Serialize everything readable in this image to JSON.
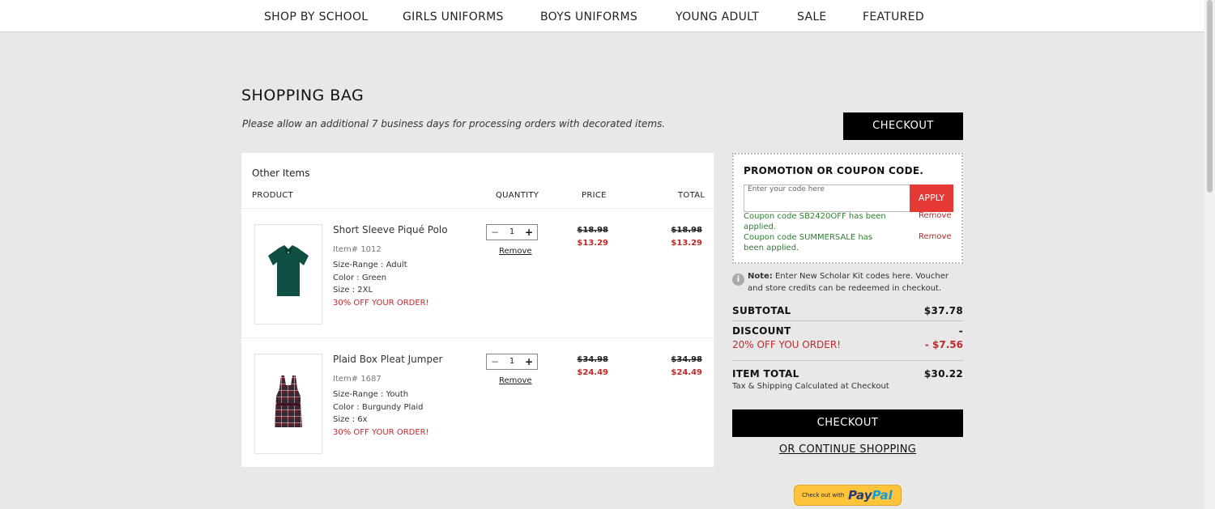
{
  "nav": {
    "items": [
      "SHOP BY SCHOOL",
      "GIRLS UNIFORMS",
      "BOYS UNIFORMS",
      "YOUNG ADULT",
      "SALE",
      "FEATURED"
    ]
  },
  "page": {
    "title": "SHOPPING BAG",
    "note": "Please allow an additional 7 business days for processing orders with decorated items.",
    "checkout_label": "CHECKOUT"
  },
  "cart": {
    "group_title": "Other Items",
    "columns": {
      "product": "PRODUCT",
      "quantity": "QUANTITY",
      "price": "PRICE",
      "total": "TOTAL"
    },
    "items": [
      {
        "name": "Short Sleeve Piqué Polo",
        "sku": "Item# 1012",
        "size_range_label": "Size-Range :",
        "size_range": "Adult",
        "color_label": "Color :",
        "color": "Green",
        "size_label": "Size :",
        "size": "2XL",
        "promo": "30% OFF YOUR ORDER!",
        "quantity": "1",
        "remove_label": "Remove",
        "price_original": "$18.98",
        "price_sale": "$13.29",
        "total_original": "$18.98",
        "total_sale": "$13.29"
      },
      {
        "name": "Plaid Box Pleat Jumper",
        "sku": "Item# 1687",
        "size_range_label": "Size-Range :",
        "size_range": "Youth",
        "color_label": "Color :",
        "color": "Burgundy Plaid",
        "size_label": "Size :",
        "size": "6x",
        "promo": "30% OFF YOUR ORDER!",
        "quantity": "1",
        "remove_label": "Remove",
        "price_original": "$34.98",
        "price_sale": "$24.49",
        "total_original": "$34.98",
        "total_sale": "$24.49"
      }
    ]
  },
  "promo": {
    "title": "PROMOTION OR COUPON CODE.",
    "placeholder": "Enter your code here",
    "apply_label": "APPLY",
    "coupons": [
      {
        "message": "Coupon code SB2420OFF has been applied.",
        "remove_label": "Remove"
      },
      {
        "message": "Coupon code SUMMERSALE has been applied.",
        "remove_label": "Remove"
      }
    ]
  },
  "info_note": {
    "bold": "Note:",
    "text": " Enter New Scholar Kit codes here. Voucher and store credits can be redeemed in checkout."
  },
  "summary": {
    "subtotal_label": "SUBTOTAL",
    "subtotal_value": "$37.78",
    "discount_label": "DISCOUNT",
    "discount_value": "-",
    "discount_line_label": "20% OFF YOU ORDER!",
    "discount_line_value": "- $7.56",
    "item_total_label": "ITEM TOTAL",
    "item_total_value": "$30.22",
    "tax_note": "Tax & Shipping Calculated at Checkout"
  },
  "continue_label": "OR CONTINUE SHOPPING",
  "paypal": {
    "small_text": "Check out with",
    "brand_a": "Pay",
    "brand_b": "Pal"
  },
  "colors": {
    "accent_red": "#e53935",
    "sale_red": "#c62828",
    "success_green": "#2e7d32",
    "black": "#000000"
  }
}
